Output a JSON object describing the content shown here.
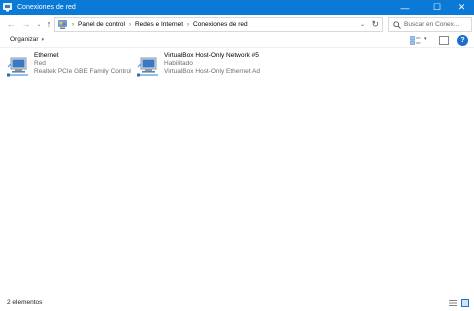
{
  "window": {
    "title": "Conexiones de red",
    "controls": {
      "minimize": "—",
      "maximize": "☐",
      "close": "✕"
    }
  },
  "nav": {
    "back": "←",
    "forward": "→",
    "recent": "⌄",
    "up": "↑",
    "breadcrumb": [
      "Panel de control",
      "Redes e Internet",
      "Conexiones de red"
    ],
    "separator": "›",
    "dropdown": "⌄",
    "refresh": "↻"
  },
  "search": {
    "placeholder": "Buscar en Conex..."
  },
  "toolbar": {
    "organize_label": "Organizar",
    "dropdown_glyph": "▾",
    "help_glyph": "?"
  },
  "connections": [
    {
      "name": "Ethernet",
      "status": "Red",
      "device": "Realtek PCIe GBE Family Controller"
    },
    {
      "name": "VirtualBox Host-Only Network #5",
      "status": "Habilitado",
      "device": "VirtualBox Host-Only Ethernet Ad..."
    }
  ],
  "statusbar": {
    "count": "2 elementos"
  },
  "colors": {
    "titlebar": "#0b79d6",
    "help": "#1e6fcc",
    "monitor": "#3a78c2",
    "cable": "#4a9ee0"
  },
  "icons": {
    "app": "network-connections-icon",
    "addressbar": "control-panel-icon",
    "search": "search-icon",
    "connection": "network-adapter-icon",
    "view": "change-view-icon",
    "preview": "preview-pane-icon",
    "help": "help-icon"
  }
}
